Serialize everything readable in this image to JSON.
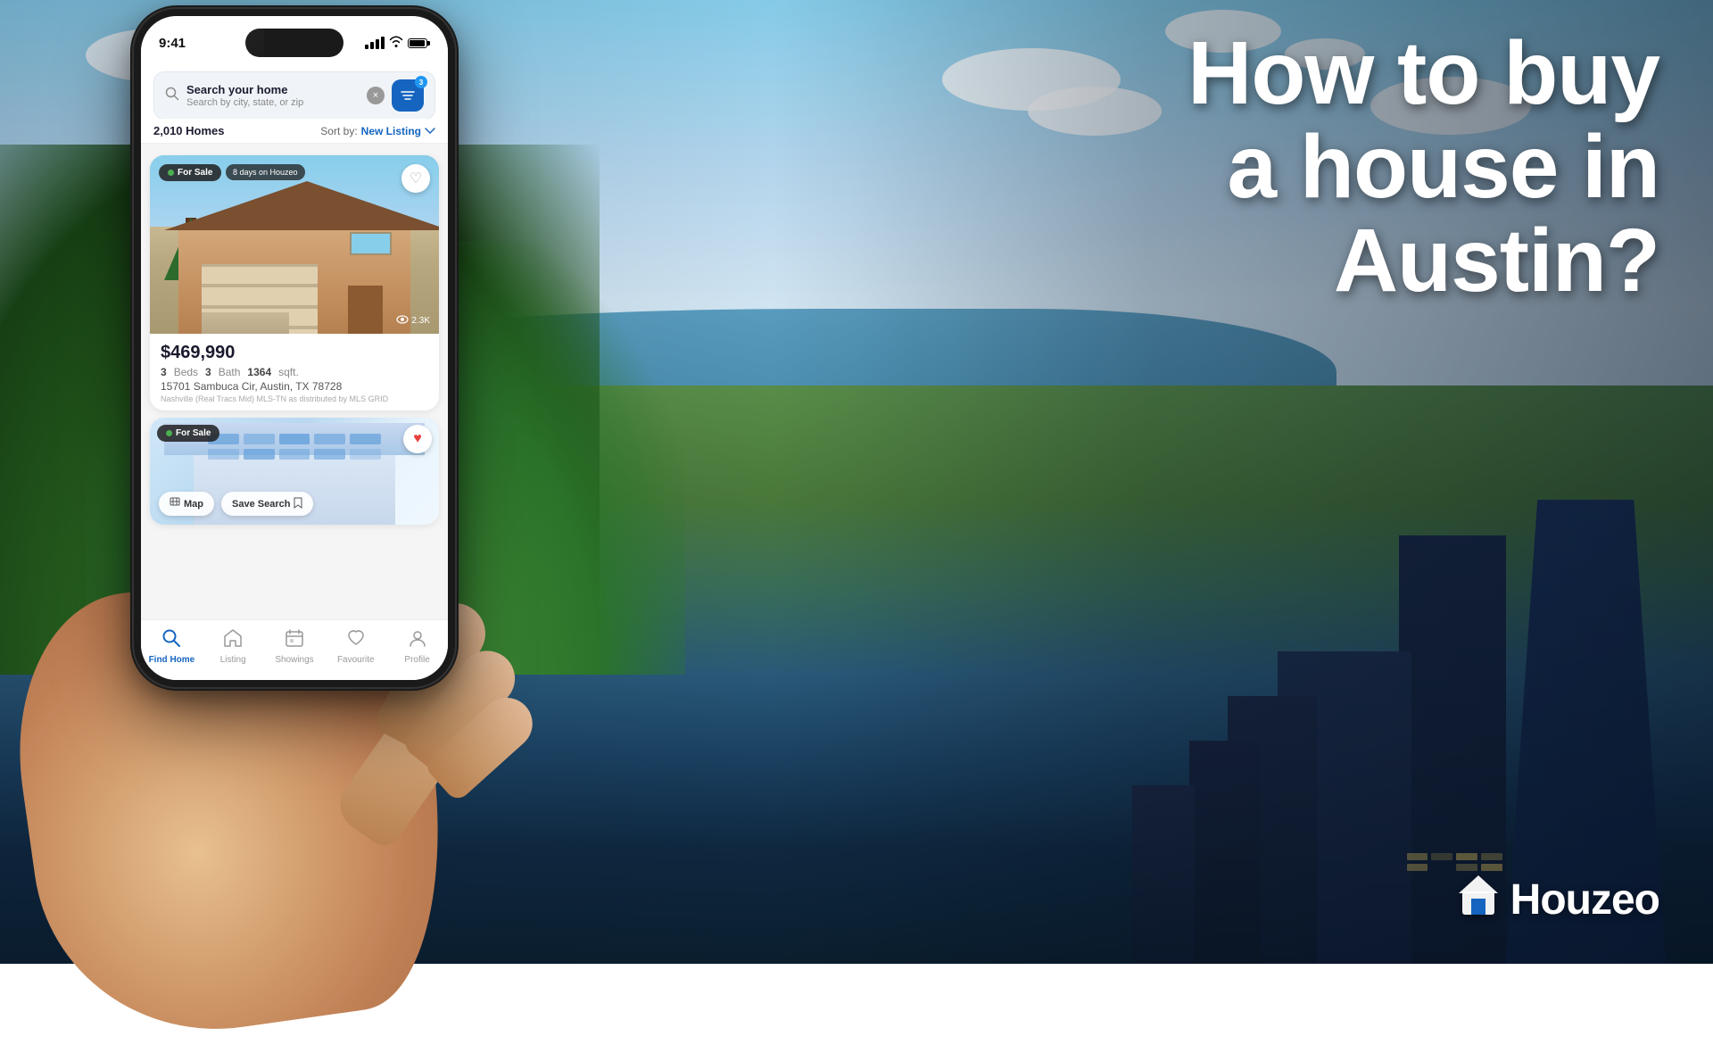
{
  "background": {
    "description": "Austin Texas aerial cityscape with river and skyline"
  },
  "headline": {
    "line1": "How to buy",
    "line2": "a house in",
    "line3": "Austin?"
  },
  "logo": {
    "name": "Houzeo",
    "icon": "🏠"
  },
  "phone": {
    "status_bar": {
      "time": "9:41",
      "signal": "4 bars",
      "wifi": true,
      "battery": "full"
    },
    "search": {
      "title": "Search your home",
      "placeholder": "Search by city, state, or zip",
      "filter_badge": "3"
    },
    "sort_bar": {
      "homes_count": "2,010 Homes",
      "sort_label": "Sort by:",
      "sort_value": "New Listing"
    },
    "listings": [
      {
        "status": "For Sale",
        "days_on": "8 days on Houzeo",
        "price": "$469,990",
        "views": "2.3K",
        "beds": "3",
        "baths": "3",
        "sqft": "1364",
        "address": "15701 Sambuca Cir, Austin, TX 78728",
        "source": "Nashville (Real Tracs Mid) MLS-TN as distributed by MLS GRID",
        "favorited": false
      },
      {
        "status": "For Sale",
        "favorited": true
      }
    ],
    "map_btn": "Map",
    "save_search_btn": "Save Search",
    "nav": {
      "items": [
        {
          "label": "Find Home",
          "icon": "search",
          "active": true
        },
        {
          "label": "Listing",
          "icon": "home",
          "active": false
        },
        {
          "label": "Showings",
          "icon": "calendar",
          "active": false
        },
        {
          "label": "Favourite",
          "icon": "heart",
          "active": false
        },
        {
          "label": "Profile",
          "icon": "person",
          "active": false
        }
      ]
    }
  }
}
